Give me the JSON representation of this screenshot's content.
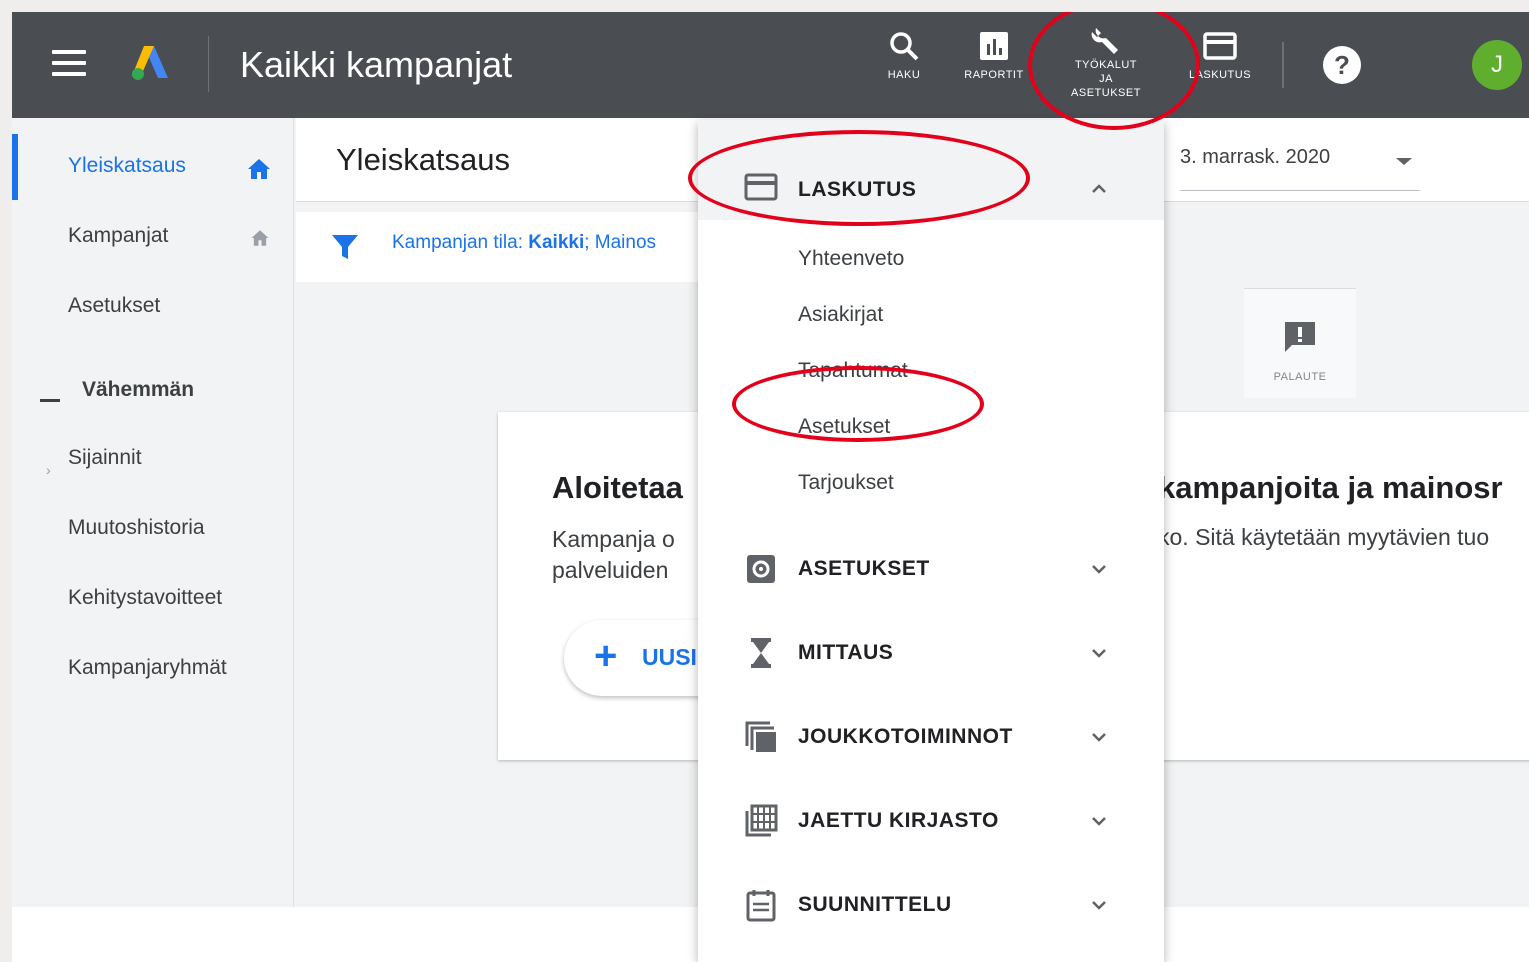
{
  "topbar": {
    "title": "Kaikki kampanjat",
    "search_label": "HAKU",
    "reports_label": "RAPORTIT",
    "tools_label_1": "TYÖKALUT",
    "tools_label_2": "JA",
    "tools_label_3": "ASETUKSET",
    "billing_label": "LASKUTUS",
    "help_glyph": "?",
    "avatar_initial": "J"
  },
  "sidebar": {
    "items": [
      {
        "label": "Yleiskatsaus",
        "icon": "home-icon"
      },
      {
        "label": "Kampanjat",
        "icon": "home-icon"
      },
      {
        "label": "Asetukset"
      },
      {
        "label": "Vähemmän"
      },
      {
        "label": "Sijainnit"
      },
      {
        "label": "Muutoshistoria"
      },
      {
        "label": "Kehitystavoitteet"
      },
      {
        "label": "Kampanjaryhmät"
      }
    ]
  },
  "main": {
    "page_title": "Yleiskatsaus",
    "date": "3. marrask. 2020",
    "filter_prefix": "Kampanjan tila: ",
    "filter_value": "Kaikki",
    "filter_suffix": "; Mainos",
    "feedback_label": "PALAUTE",
    "card_title_left": "Aloitetaa",
    "card_title_right": "kampanjoita ja mainosr",
    "card_text_line1": "Kampanja o",
    "card_text_line2": "palveluiden",
    "card_text_right": "ko. Sitä käytetään myytävien tuo",
    "new_button_label": "UUSI"
  },
  "dropdown": {
    "billing_header": "LASKUTUS",
    "billing_items": [
      "Yhteenveto",
      "Asiakirjat",
      "Tapahtumat",
      "Asetukset",
      "Tarjoukset"
    ],
    "sections": [
      "ASETUKSET",
      "MITTAUS",
      "JOUKKOTOIMINNOT",
      "JAETTU KIRJASTO",
      "SUUNNITTELU"
    ]
  },
  "colors": {
    "topbar": "#4a4d52",
    "accent": "#1a73e8",
    "annotation": "#e3001b",
    "avatar": "#5fae2d"
  }
}
